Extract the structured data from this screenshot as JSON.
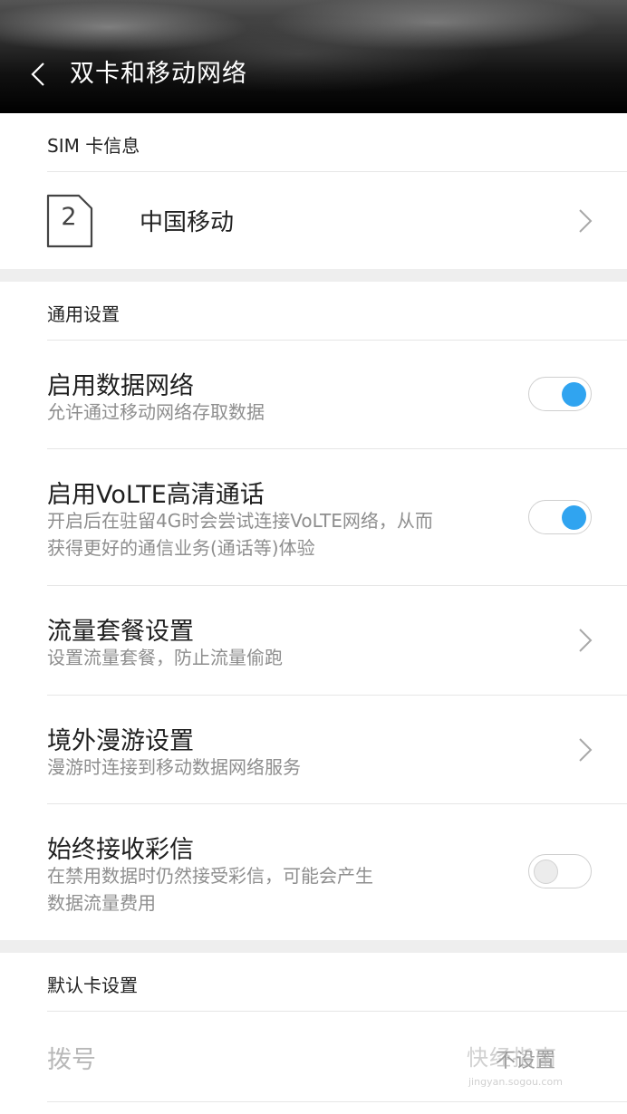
{
  "header": {
    "title": "双卡和移动网络"
  },
  "sim_section": {
    "title": "SIM 卡信息",
    "sim_slot_number": "2",
    "carrier": "中国移动"
  },
  "general_section": {
    "title": "通用设置",
    "items": [
      {
        "title": "启用数据网络",
        "subtitle": "允许通过移动网络存取数据",
        "toggle": "on"
      },
      {
        "title": "启用VoLTE高清通话",
        "subtitle_line1": "开启后在驻留4G时会尝试连接VoLTE网络，从而",
        "subtitle_line2": "获得更好的通信业务(通话等)体验",
        "toggle": "on"
      },
      {
        "title": "流量套餐设置",
        "subtitle": "设置流量套餐，防止流量偷跑"
      },
      {
        "title": "境外漫游设置",
        "subtitle": "漫游时连接到移动数据网络服务"
      },
      {
        "title": "始终接收彩信",
        "subtitle_line1": "在禁用数据时仍然接受彩信，可能会产生",
        "subtitle_line2": "数据流量费用",
        "toggle": "off"
      }
    ]
  },
  "default_card_section": {
    "title": "默认卡设置",
    "dial_label": "拨号",
    "dial_value": "不设置"
  },
  "watermark": {
    "text": "快经指南",
    "url": "jingyan.sogou.com"
  },
  "colors": {
    "accent": "#30a4f0",
    "divider": "#e6e6e6",
    "section_gap": "#eeeeee"
  }
}
